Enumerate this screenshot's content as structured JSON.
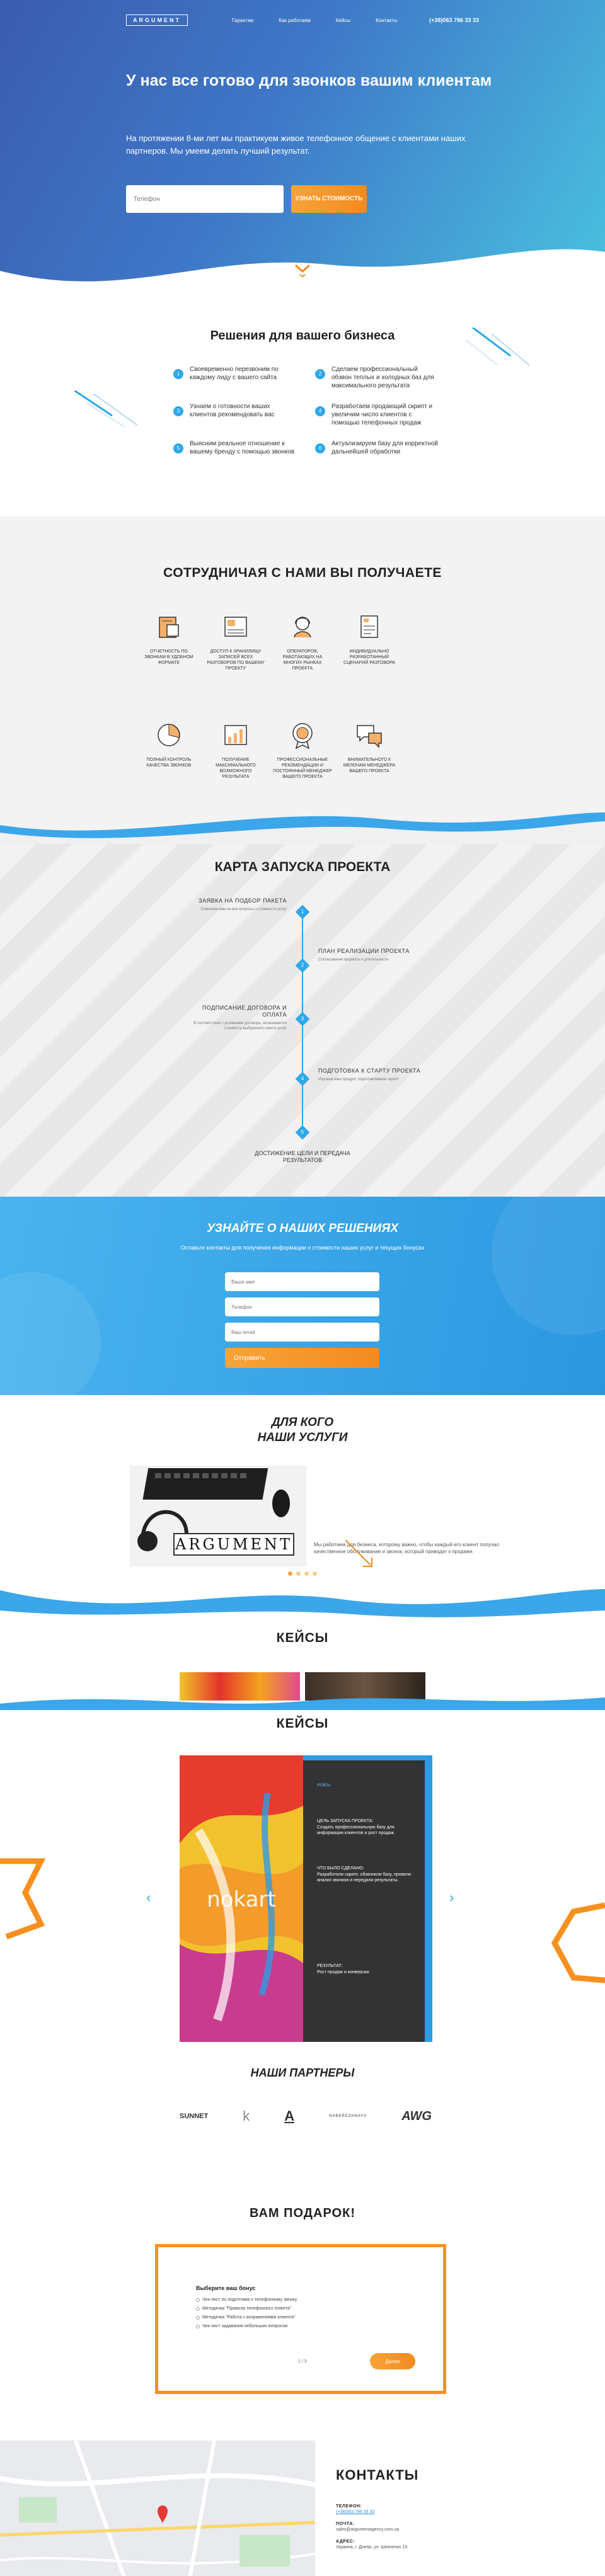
{
  "nav": {
    "logo": "ARGUMENT",
    "links": [
      "Гарантии",
      "Как работаем",
      "Кейсы",
      "Контакты"
    ],
    "phone": "(+38)063 786 33 33"
  },
  "hero": {
    "title": "У нас все готово для звонков вашим клиентам",
    "subtitle": "На протяжении 8-ми лет мы практикуем живое телефонное общение с клиентами наших партнеров. Мы умеем делать лучший результат.",
    "input_placeholder": "Телефон",
    "cta": "УЗНАТЬ СТОИМОСТЬ"
  },
  "solutions": {
    "title": "Решения для вашего бизнеса",
    "items": [
      {
        "n": "1",
        "text": "Своевременно перезвоним по каждому лиду с вашего сайта"
      },
      {
        "n": "2",
        "text": "Сделаем профессиональный обзвон теплых и холодных баз для максимального результата"
      },
      {
        "n": "3",
        "text": "Узнаем о готовности ваших клиентов рекомендовать вас"
      },
      {
        "n": "4",
        "text": "Разработаем продающий скрипт и увеличим число клиентов с помощью телефонных продаж"
      },
      {
        "n": "5",
        "text": "Выясним реальное отношение к вашему бренду с помощью звонков"
      },
      {
        "n": "6",
        "text": "Актуализируем базу для корректной дальнейшей обработки"
      }
    ]
  },
  "benefits": {
    "title": "СОТРУДНИЧАЯ С НАМИ ВЫ ПОЛУЧАЕТЕ",
    "row1": [
      {
        "icon": "report-icon",
        "text": "ОТЧЕТНОСТЬ ПО ЗВОНКАМ В УДОБНОМ ФОРМАТЕ"
      },
      {
        "icon": "recordings-icon",
        "text": "ДОСТУП К ХРАНИЛИЩУ ЗАПИСЕЙ ВСЕХ РАЗГОВОРОВ ПО ВАШЕМУ ПРОЕКТУ"
      },
      {
        "icon": "operator-icon",
        "text": "ОПЕРАТОРОВ, РАБОТАЮЩИХ НА МНОГИХ РЫНКАХ ПРОЕКТА"
      },
      {
        "icon": "document-icon",
        "text": "ИНДИВИДУАЛЬНО РАЗРАБОТАННЫЙ СЦЕНАРИЙ РАЗГОВОРА"
      }
    ],
    "row2": [
      {
        "icon": "pie-chart-icon",
        "text": "ПОЛНЫЙ КОНТРОЛЬ КАЧЕСТВА ЗВОНКОВ"
      },
      {
        "icon": "bar-chart-icon",
        "text": "ПОЛУЧЕНИЕ МАКСИМАЛЬНОГО ВОЗМОЖНОГО РЕЗУЛЬТАТА"
      },
      {
        "icon": "badge-icon",
        "text": "ПРОФЕССИОНАЛЬНЫЕ РЕКОМЕНДАЦИИ И ПОСТОЯННЫЙ МЕНЕДЖЕР ВАШЕГО ПРОЕКТА"
      },
      {
        "icon": "chat-icon",
        "text": "ВНИМАТЕЛЬНОГО К МЕЛОЧАМ МЕНЕДЖЕРА ВАШЕГО ПРОЕКТА"
      }
    ]
  },
  "roadmap": {
    "title": "КАРТА ЗАПУСКА ПРОЕКТА",
    "steps": [
      {
        "n": "1",
        "title": "ЗАЯВКА НА ПОДБОР ПАКЕТА",
        "desc": "Отвечаем вам на все вопросы о стоимости услуг"
      },
      {
        "n": "2",
        "title": "ПЛАН РЕАЛИЗАЦИИ ПРОЕКТА",
        "desc": "Согласование формата и длительности"
      },
      {
        "n": "3",
        "title": "ПОДПИСАНИЕ ДОГОВОРА И ОПЛАТА",
        "desc": "В соответствии с условиями договора, оплачивается стоимость выбранного пакета услуг"
      },
      {
        "n": "4",
        "title": "ПОДГОТОВКА К СТАРТУ ПРОЕКТА",
        "desc": "Изучаем ваш продукт, подготавливаем скрипт"
      },
      {
        "n": "5",
        "title": "ДОСТИЖЕНИЕ ЦЕЛИ И ПЕРЕДАЧА РЕЗУЛЬТАТОВ",
        "desc": ""
      }
    ]
  },
  "subscribe": {
    "title": "УЗНАЙТЕ О НАШИХ РЕШЕНИЯХ",
    "text": "Оставьте контакты для получения информации о стоимости наших услуг и текущих бонусах",
    "fields": [
      "Ваше имя",
      "Телефон",
      "Ваш email"
    ],
    "button": "Отправить"
  },
  "audience": {
    "title_line1": "ДЛЯ КОГО",
    "title_line2": "НАШИ УСЛУГИ",
    "image_label": "ARGUMENT",
    "text": "Мы работаем для бизнеса, которому важно, чтобы каждый его клиент получал качественное обслуживание и звонок, который приводит к продаже."
  },
  "cases": {
    "title": "КЕЙСЫ",
    "brand": "nokart",
    "label": "КЕЙСЫ",
    "goal_label": "ЦЕЛЬ ЗАПУСКА ПРОЕКТА:",
    "goal": "Создать профессиональную базу для информации клиентов и рост продаж.",
    "done_label": "ЧТО БЫЛО СДЕЛАНО:",
    "done": "Разработали скрипт, обзвонили базу, провели анализ звонков и передали результаты.",
    "result_label": "РЕЗУЛЬТАТ:",
    "result": "Рост продаж и конверсии."
  },
  "partners": {
    "title": "НАШИ ПАРТНЕРЫ",
    "logos": [
      "SUNNET",
      "k",
      "A",
      "NABEREZHNAYA",
      "AWG"
    ]
  },
  "gift": {
    "title": "ВАМ ПОДАРОК!",
    "question": "Выберите ваш бонус",
    "options": [
      "Чек-лист по подготовке к телефонному звонку",
      "Методичка \"Правила телефонного этикета\"",
      "Методичка \"Работа с возражениями клиента\"",
      "Чек-лист задавания небольших вопросов"
    ],
    "page": "1 / 3",
    "next": "Далее"
  },
  "contacts": {
    "title": "КОНТАКТЫ",
    "phone_label": "ТЕЛЕФОН:",
    "phone": "(+38)063 786 33 33",
    "email_label": "ПОЧТА:",
    "email": "sales@argumentagency.com.ua",
    "address_label": "АДРЕС:",
    "address": "Украина, г. Днепр, ул. Шевченко 10"
  },
  "colors": {
    "accent": "#2ea8e8",
    "orange": "#f7901e",
    "hero_from": "#3b5cb0",
    "hero_to": "#4ac3e0"
  }
}
